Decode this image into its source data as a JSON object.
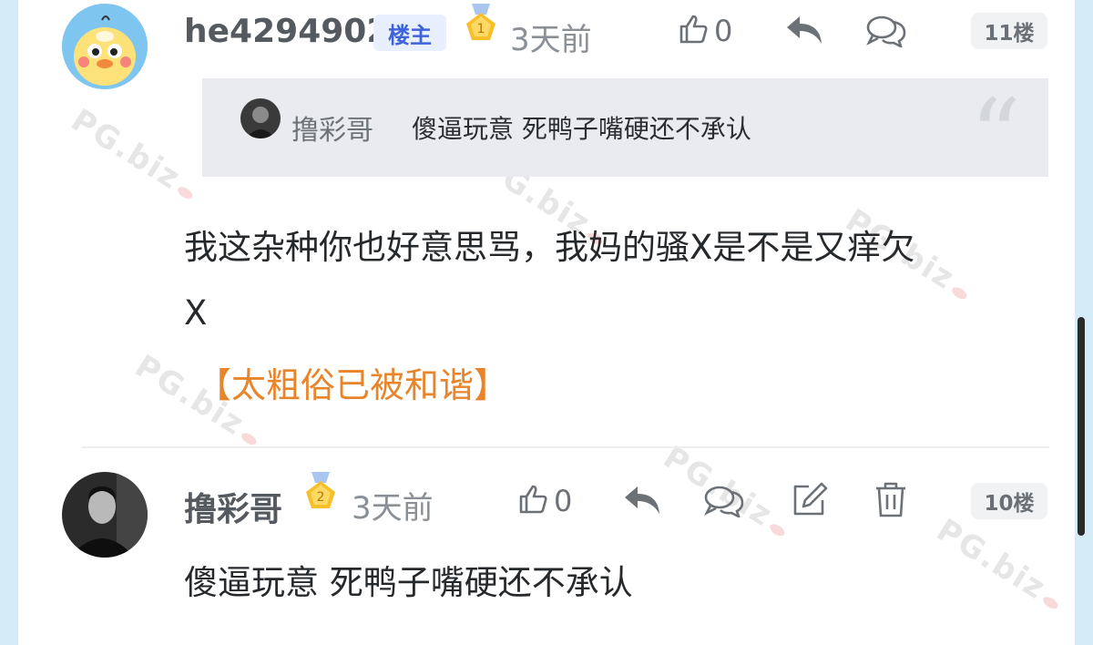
{
  "colors": {
    "accent": "#3f63d8",
    "moderated": "#e8842a",
    "background": "#d4ecf8"
  },
  "watermark": {
    "text": "PG.biz"
  },
  "comments": [
    {
      "username": "he4294902",
      "host_badge": "楼主",
      "medal_level": "1",
      "time": "3天前",
      "likes": "0",
      "floor": "11楼",
      "quote": {
        "username": "撸彩哥",
        "text": "傻逼玩意 死鸭子嘴硬还不承认"
      },
      "text_line1": "我这杂种你也好意思骂，我妈的骚X是不是又痒欠",
      "text_line2": "X",
      "moderation_note": "【太粗俗已被和谐】",
      "actions": [
        "like-icon",
        "reply-icon",
        "comment-icon"
      ]
    },
    {
      "username": "撸彩哥",
      "medal_level": "2",
      "time": "3天前",
      "likes": "0",
      "floor": "10楼",
      "text": "傻逼玩意 死鸭子嘴硬还不承认",
      "actions": [
        "like-icon",
        "reply-icon",
        "comment-icon",
        "edit-icon",
        "delete-icon"
      ]
    }
  ]
}
